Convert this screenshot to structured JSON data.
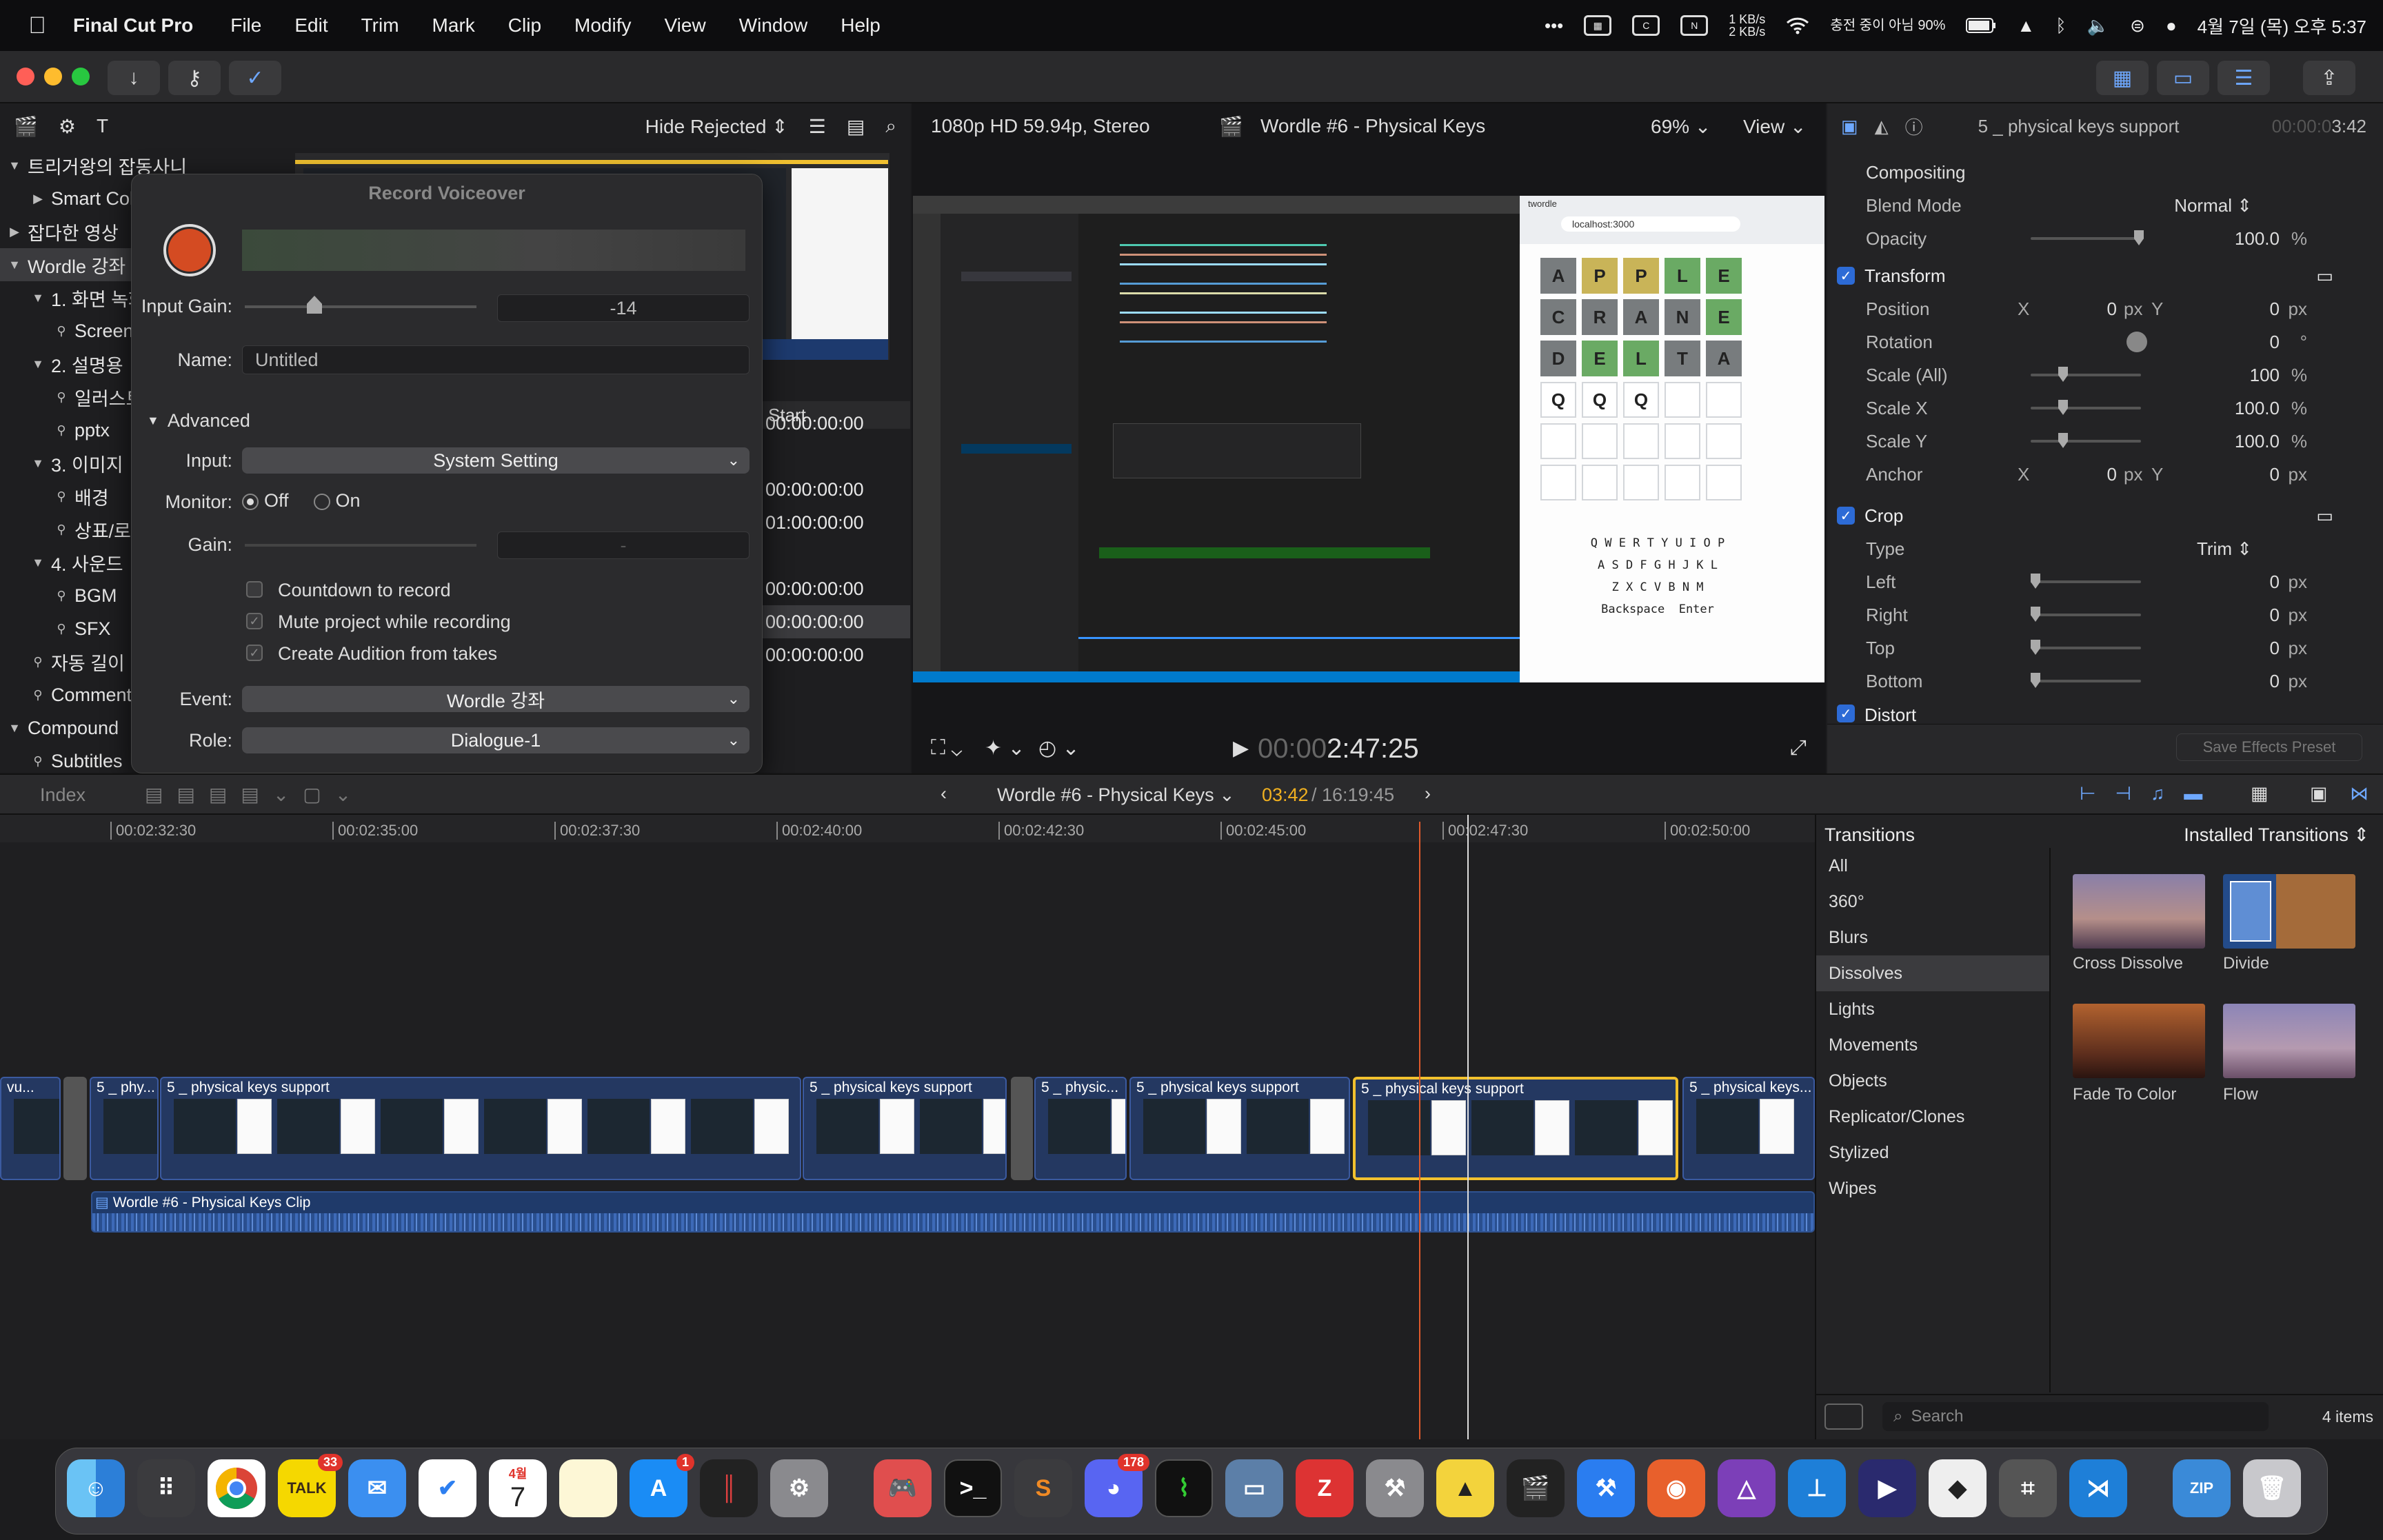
{
  "menubar": {
    "app": "Final Cut Pro",
    "items": [
      "File",
      "Edit",
      "Trim",
      "Mark",
      "Clip",
      "Modify",
      "View",
      "Window",
      "Help"
    ],
    "net_speed": "1 KB/s\n2 KB/s",
    "battery": "90%",
    "battery_note": "충전 중이 아님",
    "clock": "4월 7일 (목) 오후 5:37"
  },
  "browser": {
    "filter": "Hide Rejected",
    "library": [
      {
        "label": "트리거왕의 잡동사니",
        "indent": 0,
        "tri": "▼"
      },
      {
        "label": "Smart Collections",
        "indent": 1,
        "tri": "▶"
      },
      {
        "label": "잡다한 영상",
        "indent": 0,
        "tri": "▶"
      },
      {
        "label": "Wordle 강좌",
        "indent": 0,
        "tri": "▼",
        "selected": true
      },
      {
        "label": "1. 화면 녹화",
        "indent": 1,
        "tri": "▼"
      },
      {
        "label": "Screen",
        "indent": 2,
        "tri": ""
      },
      {
        "label": "2. 설명용",
        "indent": 1,
        "tri": "▼"
      },
      {
        "label": "일러스트",
        "indent": 2,
        "tri": ""
      },
      {
        "label": "pptx",
        "indent": 2,
        "tri": ""
      },
      {
        "label": "3. 이미지",
        "indent": 1,
        "tri": "▼"
      },
      {
        "label": "배경",
        "indent": 2,
        "tri": ""
      },
      {
        "label": "상표/로고",
        "indent": 2,
        "tri": ""
      },
      {
        "label": "4. 사운드",
        "indent": 1,
        "tri": "▼"
      },
      {
        "label": "BGM",
        "indent": 2,
        "tri": ""
      },
      {
        "label": "SFX",
        "indent": 2,
        "tri": ""
      },
      {
        "label": "자동 길이",
        "indent": 1,
        "tri": ""
      },
      {
        "label": "Comments",
        "indent": 1,
        "tri": ""
      },
      {
        "label": "Compound",
        "indent": 0,
        "tri": "▼"
      },
      {
        "label": "Subtitles",
        "indent": 1,
        "tri": ""
      }
    ],
    "start_header": "Start",
    "starts": [
      "00:00:00:00",
      "",
      "00:00:00:00",
      "01:00:00:00",
      "",
      "00:00:00:00",
      "00:00:00:00",
      "00:00:00:00"
    ]
  },
  "voiceover": {
    "title": "Record Voiceover",
    "input_gain_label": "Input Gain:",
    "input_gain_value": "-14",
    "name_label": "Name:",
    "name_value": "Untitled",
    "advanced_label": "Advanced",
    "input_label": "Input:",
    "input_value": "System Setting",
    "monitor_label": "Monitor:",
    "monitor_off": "Off",
    "monitor_on": "On",
    "gain_label": "Gain:",
    "gain_value": "-",
    "countdown": "Countdown to record",
    "mute": "Mute project while recording",
    "audition": "Create Audition from takes",
    "event_label": "Event:",
    "event_value": "Wordle 강좌",
    "role_label": "Role:",
    "role_value": "Dialogue-1"
  },
  "viewer": {
    "format": "1080p HD 59.94p, Stereo",
    "title": "Wordle #6 - Physical Keys",
    "zoom": "69%",
    "view": "View",
    "timecode_dim": "00:00",
    "timecode": "2:47:25"
  },
  "wordle": {
    "rows": [
      [
        [
          "A",
          "g"
        ],
        [
          "P",
          "y"
        ],
        [
          "P",
          "y"
        ],
        [
          "L",
          "l"
        ],
        [
          "E",
          "l"
        ]
      ],
      [
        [
          "C",
          "g"
        ],
        [
          "R",
          "g"
        ],
        [
          "A",
          "g"
        ],
        [
          "N",
          "g"
        ],
        [
          "E",
          "l"
        ]
      ],
      [
        [
          "D",
          "g"
        ],
        [
          "E",
          "l"
        ],
        [
          "L",
          "l"
        ],
        [
          "T",
          "g"
        ],
        [
          "A",
          "g"
        ]
      ],
      [
        [
          "Q",
          "w"
        ],
        [
          "Q",
          "w"
        ],
        [
          "Q",
          "w"
        ],
        [
          "",
          "w"
        ],
        [
          "",
          "w"
        ]
      ],
      [
        [
          "",
          "w"
        ],
        [
          "",
          "w"
        ],
        [
          "",
          "w"
        ],
        [
          "",
          "w"
        ],
        [
          "",
          "w"
        ]
      ],
      [
        [
          "",
          "w"
        ],
        [
          "",
          "w"
        ],
        [
          "",
          "w"
        ],
        [
          "",
          "w"
        ],
        [
          "",
          "w"
        ]
      ]
    ],
    "kb1": "Q W E R T Y U I O P",
    "kb2": "A S D F G H J K L",
    "kb3": "Z X C V B N M",
    "backspace": "Backspace",
    "enter": "Enter",
    "url": "localhost:3000",
    "tab": "twordle"
  },
  "inspector": {
    "clip_name": "5 _ physical keys support",
    "duration_dim": "00:00:0",
    "duration": "3:42",
    "compositing": "Compositing",
    "blend_mode_label": "Blend Mode",
    "blend_mode": "Normal",
    "opacity_label": "Opacity",
    "opacity": "100.0",
    "transform": "Transform",
    "position_label": "Position",
    "position_x": "0",
    "position_y": "0",
    "rotation_label": "Rotation",
    "rotation": "0",
    "scale_all_label": "Scale (All)",
    "scale_all": "100",
    "scale_x_label": "Scale X",
    "scale_x": "100.0",
    "scale_y_label": "Scale Y",
    "scale_y": "100.0",
    "anchor_label": "Anchor",
    "anchor_x": "0",
    "anchor_y": "0",
    "crop": "Crop",
    "type_label": "Type",
    "type_value": "Trim",
    "left_label": "Left",
    "left": "0",
    "right_label": "Right",
    "right": "0",
    "top_label": "Top",
    "top": "0",
    "bottom_label": "Bottom",
    "bottom": "0",
    "distort": "Distort",
    "save_preset": "Save Effects Preset",
    "px": "px",
    "pct": "%",
    "deg": "°",
    "x": "X",
    "y": "Y"
  },
  "midbar": {
    "index": "Index",
    "project": "Wordle #6 - Physical Keys",
    "pos": "03:42",
    "total": "/ 16:19:45"
  },
  "timeline": {
    "ticks": [
      "00:02:32:30",
      "00:02:35:00",
      "00:02:37:30",
      "00:02:40:00",
      "00:02:42:30",
      "00:02:45:00",
      "00:02:47:30",
      "00:02:50:00"
    ],
    "clips": [
      "vu...",
      "5 _ phy...",
      "5 _ physical keys support",
      "5 _ physical keys support",
      "5 _ physic...",
      "5 _ physical keys support",
      "5 _ physical keys support",
      "5 _ physical keys..."
    ],
    "audio": "Wordle #6 - Physical Keys Clip"
  },
  "transitions": {
    "title": "Transitions",
    "installed": "Installed Transitions",
    "categories": [
      "All",
      "360°",
      "Blurs",
      "Dissolves",
      "Lights",
      "Movements",
      "Objects",
      "Replicator/Clones",
      "Stylized",
      "Wipes"
    ],
    "selected": "Dissolves",
    "items": [
      "Cross Dissolve",
      "Divide",
      "Fade To Color",
      "Flow"
    ],
    "search": "Search",
    "count": "4 items"
  },
  "dock": {
    "badge_talk": "33",
    "badge_appstore": "1",
    "badge_discord": "178",
    "calendar_month": "4월",
    "calendar_day": "7",
    "talk_label": "TALK",
    "zip_label": "ZIP"
  }
}
